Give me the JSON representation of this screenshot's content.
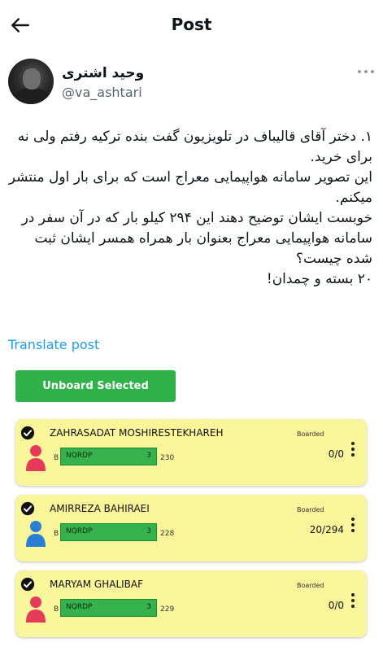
{
  "header": {
    "title": "Post"
  },
  "author": {
    "name": "وحید اشتری",
    "handle": "@va_ashtari"
  },
  "post": {
    "text": "۱. دختر آقای قالیباف در تلویزیون گفت بنده ترکیه رفتم ولی نه برای خرید.\nاین تصویر سامانه هواپیمایی معراج است که برای بار اول منتشر میکنم.\nخوبست ایشان توضیح دهند این ۲۹۴ کیلو بار که در آن سفر در سامانه هواپیمایی معراج بعنوان بار همراه همسر ایشان ثبت شده چیست؟\n۲۰ بسته و چمدان!",
    "translate_label": "Translate post"
  },
  "screenshot": {
    "unboard_label": "Unboard Selected",
    "passengers": [
      {
        "name": "ZAHRASADAT MOSHIRESTEKHAREH",
        "status": "Boarded",
        "class": "B",
        "code": "NQRDP",
        "num": "3",
        "seat": "230",
        "bags": "0/0",
        "gender": "female"
      },
      {
        "name": "AMIRREZA BAHIRAEI",
        "status": "Boarded",
        "class": "B",
        "code": "NQRDP",
        "num": "3",
        "seat": "228",
        "bags": "20/294",
        "gender": "male"
      },
      {
        "name": "MARYAM GHALIBAF",
        "status": "Boarded",
        "class": "B",
        "code": "NQRDP",
        "num": "3",
        "seat": "229",
        "bags": "0/0",
        "gender": "female"
      }
    ]
  },
  "colors": {
    "card_bg": "#f9f59a",
    "button_green": "#2fb24a",
    "link_blue": "#1d9bf0",
    "female_icon": "#e53a5a",
    "male_icon": "#2a7fd4"
  }
}
